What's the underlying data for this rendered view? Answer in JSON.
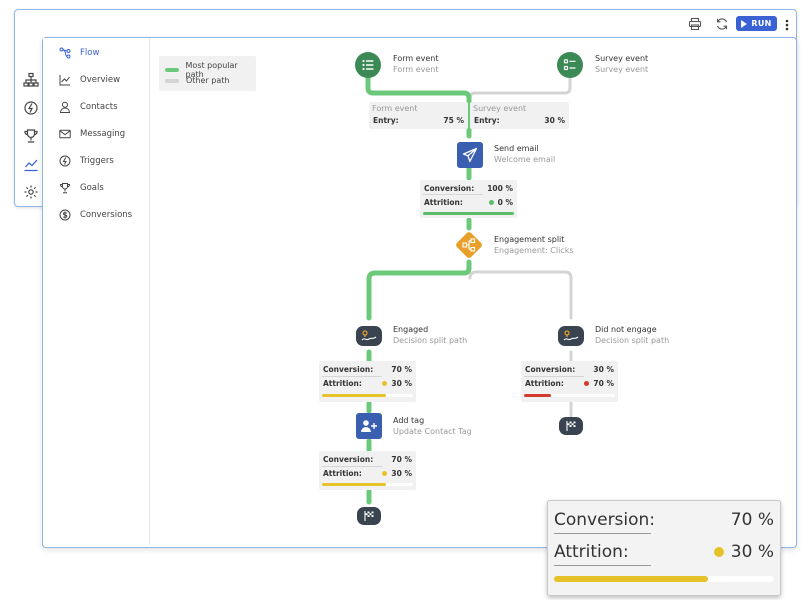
{
  "toolbar": {
    "run_label": "RUN",
    "print_icon": "printer-icon",
    "refresh_icon": "refresh-icon",
    "more_icon": "more-vertical-icon"
  },
  "rail": [
    "hierarchy-icon",
    "triggers-icon",
    "trophy-icon",
    "analytics-icon",
    "settings-icon"
  ],
  "nav": {
    "items": [
      {
        "label": "Flow",
        "icon": "flow-icon",
        "active": true
      },
      {
        "label": "Overview",
        "icon": "chart-line-icon"
      },
      {
        "label": "Contacts",
        "icon": "user-icon"
      },
      {
        "label": "Messaging",
        "icon": "envelope-icon"
      },
      {
        "label": "Triggers",
        "icon": "bolt-icon"
      },
      {
        "label": "Goals",
        "icon": "trophy-icon"
      },
      {
        "label": "Conversions",
        "icon": "dollar-icon"
      }
    ]
  },
  "legend": {
    "popular": "Most popular path",
    "other": "Other path",
    "popular_color": "#6cc97a",
    "other_color": "#d4d4d4"
  },
  "flow": {
    "form_event": {
      "title": "Form event",
      "sub": "Form event"
    },
    "survey_event": {
      "title": "Survey event",
      "sub": "Survey event"
    },
    "entry_form": {
      "head": "Form event",
      "label": "Entry:",
      "value": "75 %"
    },
    "entry_survey": {
      "head": "Survey event",
      "label": "Entry:",
      "value": "30 %"
    },
    "send_email": {
      "title": "Send email",
      "sub": "Welcome email"
    },
    "email_stats": {
      "conv_label": "Conversion:",
      "conv_value": "100 %",
      "attr_label": "Attrition:",
      "attr_value": "0 %",
      "fill": 1.0,
      "color": "#5bbd6a"
    },
    "split": {
      "title": "Engagement split",
      "sub": "Engagement: Clicks"
    },
    "engaged": {
      "title": "Engaged",
      "sub": "Decision split path"
    },
    "not_engaged": {
      "title": "Did not engage",
      "sub": "Decision split path"
    },
    "engaged_stats": {
      "conv_label": "Conversion:",
      "conv_value": "70 %",
      "attr_label": "Attrition:",
      "attr_value": "30 %",
      "fill": 0.7,
      "color": "#e6c229"
    },
    "not_engaged_stats": {
      "conv_label": "Conversion:",
      "conv_value": "30 %",
      "attr_label": "Attrition:",
      "attr_value": "70 %",
      "fill": 0.3,
      "color": "#d33a2c"
    },
    "add_tag": {
      "title": "Add tag",
      "sub": "Update Contact Tag"
    },
    "tag_stats": {
      "conv_label": "Conversion:",
      "conv_value": "70 %",
      "attr_label": "Attrition:",
      "attr_value": "30 %",
      "fill": 0.7,
      "color": "#e6c229"
    }
  },
  "zoom": {
    "conv_label": "Conversion:",
    "conv_value": "70 %",
    "attr_label": "Attrition:",
    "attr_value": "30 %",
    "fill": 0.7,
    "color": "#e6c229"
  }
}
